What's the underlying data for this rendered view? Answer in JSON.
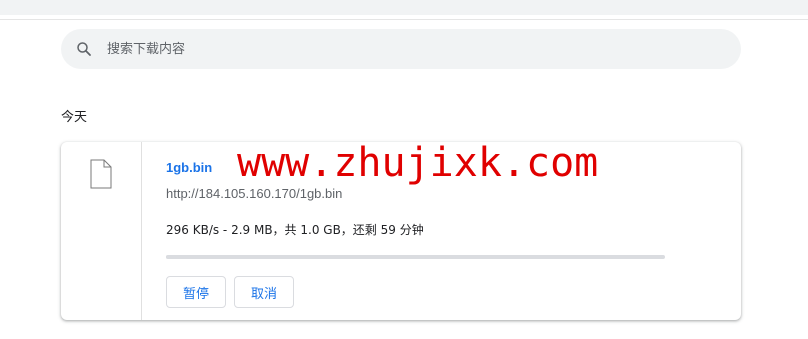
{
  "search": {
    "placeholder": "搜索下载内容"
  },
  "section": {
    "title": "今天"
  },
  "download": {
    "file_name": "1gb.bin",
    "url": "http://184.105.160.170/1gb.bin",
    "status": "296 KB/s - 2.9 MB，共 1.0 GB，还剩 59 分钟",
    "progress_fraction": 0.003,
    "buttons": {
      "pause": "暂停",
      "cancel": "取消"
    }
  },
  "watermark": "www.zhujixk.com",
  "colors": {
    "accent": "#1a73e8",
    "watermark": "#e00000",
    "search_bg": "#f1f3f4"
  }
}
